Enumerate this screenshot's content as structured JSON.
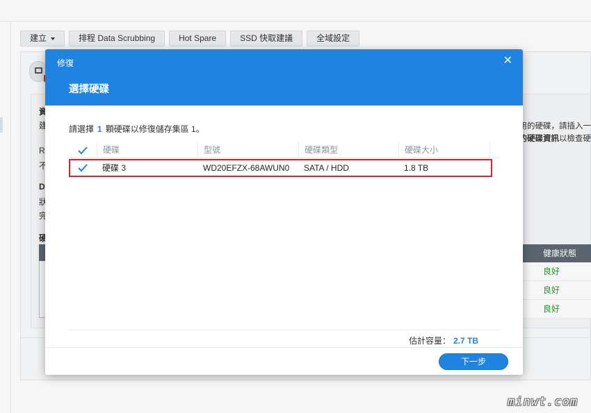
{
  "toolbar": {
    "create_label": "建立",
    "scrubbing_label": "排程 Data Scrubbing",
    "hotspare_label": "Hot Spare",
    "ssd_label": "SSD 快取建議",
    "global_label": "全域設定"
  },
  "background": {
    "left_chars": [
      "資",
      "建",
      "R",
      "不",
      "D",
      "狀",
      "完",
      "硬"
    ],
    "right_text_1": "使用的硬碟，請插入一",
    "right_text_2_bold": "的硬碟資訊",
    "right_text_2_pre": "",
    "right_text_2_post": "以檢查硬",
    "health": {
      "header": "健康狀態",
      "rows": [
        "良好",
        "良好",
        "良好"
      ]
    }
  },
  "dialog": {
    "title": "修復",
    "close_glyph": "✕",
    "subtitle": "選擇硬碟",
    "instruction_pre": "請選擇",
    "instruction_count": "1",
    "instruction_post": "顆硬碟以修復儲存集區 1。",
    "table": {
      "columns": [
        "硬碟",
        "型號",
        "硬碟類型",
        "硬碟大小"
      ],
      "rows": [
        {
          "disk": "硬碟 3",
          "model": "WD20EFZX-68AWUN0",
          "type": "SATA / HDD",
          "size": "1.8 TB",
          "checked": true
        }
      ]
    },
    "capacity_label": "估計容量：",
    "capacity_value": "2.7 TB",
    "next_label": "下一步"
  },
  "watermark": "minwt.com",
  "colors": {
    "accent": "#1f83e2",
    "highlight_border": "#d9242b",
    "health_good": "#1f9b2a"
  }
}
